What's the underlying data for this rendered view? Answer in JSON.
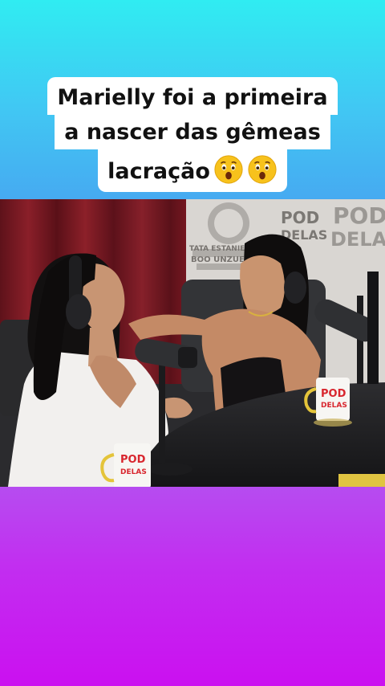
{
  "caption": {
    "line1": "Marielly foi a primeira",
    "line2": "a nascer das gêmeas",
    "line3": "lacração",
    "emojis": [
      "astonished-face-emoji",
      "astonished-face-emoji"
    ]
  },
  "scene": {
    "wall_logo_lines": [
      "POD",
      "DELAS"
    ],
    "wall_logo_lines_b": [
      "POD",
      "DELAS"
    ],
    "wall_text": [
      "TATA ESTANIECK",
      "BOO UNZUETA"
    ],
    "mug_left": [
      "POD",
      "DELAS"
    ],
    "mug_right": [
      "POD",
      "DELAS"
    ]
  },
  "colors": {
    "top_gradient": "#41c7f3",
    "bottom_gradient": "#c22ef0",
    "caption_bg": "#ffffff",
    "curtain": "#7a1822",
    "mug_logo": "#d8262e"
  }
}
